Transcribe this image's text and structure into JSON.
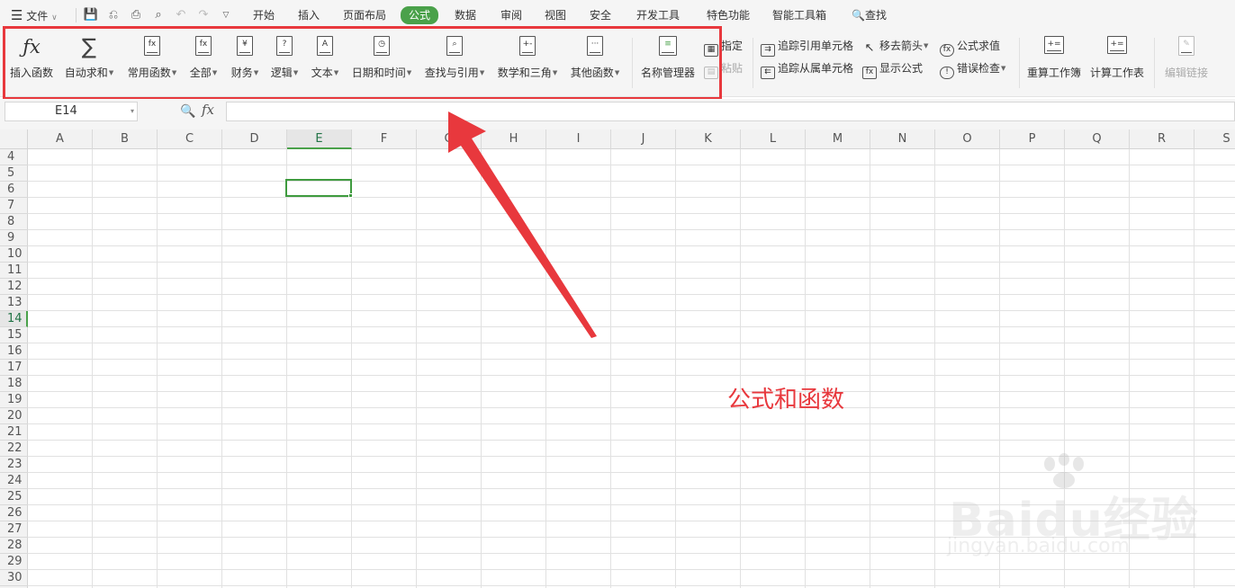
{
  "menubar": {
    "file_label": "文件",
    "tabs": [
      "开始",
      "插入",
      "页面布局",
      "公式",
      "数据",
      "审阅",
      "视图",
      "安全",
      "开发工具",
      "特色功能",
      "智能工具箱"
    ],
    "active_tab": "公式",
    "search_label": "查找"
  },
  "ribbon": {
    "insert_function": "插入函数",
    "autosum": "自动求和",
    "common_functions": "常用函数",
    "all": "全部",
    "financial": "财务",
    "logical": "逻辑",
    "text": "文本",
    "date_time": "日期和时间",
    "lookup_ref": "查找与引用",
    "math_trig": "数学和三角",
    "other_functions": "其他函数",
    "name_manager": "名称管理器",
    "specify": "指定",
    "paste": "粘贴",
    "trace_precedents": "追踪引用单元格",
    "trace_dependents": "追踪从属单元格",
    "remove_arrows": "移去箭头",
    "show_formulas": "显示公式",
    "evaluate_formula": "公式求值",
    "error_checking": "错误检查",
    "recalc_workbook": "重算工作簿",
    "calc_sheet": "计算工作表",
    "edit_links": "编辑链接"
  },
  "formula_bar": {
    "name_box": "E14",
    "fx": "fx",
    "value": ""
  },
  "grid": {
    "columns": [
      "A",
      "B",
      "C",
      "D",
      "E",
      "F",
      "G",
      "H",
      "I",
      "J",
      "K",
      "L",
      "M",
      "N",
      "O",
      "P",
      "Q",
      "R",
      "S"
    ],
    "rows": [
      "4",
      "5",
      "6",
      "7",
      "8",
      "9",
      "10",
      "11",
      "12",
      "13",
      "14",
      "15",
      "16",
      "17",
      "18",
      "19",
      "20",
      "21",
      "22",
      "23",
      "24",
      "25",
      "26",
      "27",
      "28",
      "29",
      "30"
    ],
    "selected_column": "E",
    "selected_row": "14"
  },
  "annotation": {
    "label": "公式和函数",
    "color": "#e8383d"
  },
  "colors": {
    "accent_green": "#4aa14a",
    "highlight_red": "#e8383d"
  },
  "watermark": {
    "brand": "Baidu经验",
    "url": "jingyan.baidu.com"
  }
}
